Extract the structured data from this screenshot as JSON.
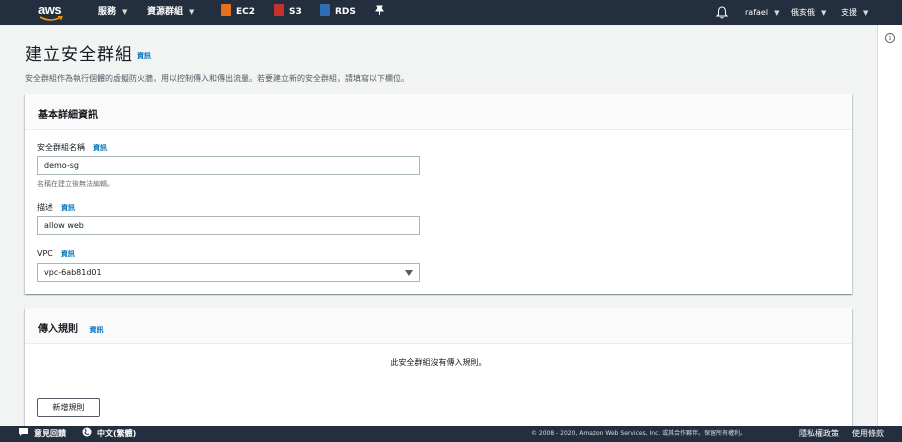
{
  "topnav": {
    "logo_text": "aws",
    "services_label": "服務",
    "resource_groups_label": "資源群組",
    "pinned": [
      {
        "label": "EC2",
        "color": "#e7711b"
      },
      {
        "label": "S3",
        "color": "#c7322f"
      },
      {
        "label": "RDS",
        "color": "#2f6db5"
      }
    ],
    "user_label": "rafael",
    "region_label": "俄亥俄",
    "support_label": "支援",
    "bg_color": "#232f3e"
  },
  "page": {
    "title": "建立安全群組",
    "title_info": "資訊",
    "description": "安全群組作為執行個體的虛擬防火牆，用以控制傳入和傳出流量。若要建立新的安全群組，請填寫以下欄位。"
  },
  "basic_details": {
    "title": "基本詳細資訊",
    "name_label": "安全群組名稱",
    "name_info": "資訊",
    "name_value": "demo-sg",
    "name_hint": "名稱在建立後無法編輯。",
    "desc_label": "描述",
    "desc_info": "資訊",
    "desc_value": "allow web",
    "vpc_label": "VPC",
    "vpc_info": "資訊",
    "vpc_value": "vpc-6ab81d01"
  },
  "inbound_rules": {
    "title": "傳入規則",
    "info": "資訊",
    "empty_text": "此安全群組沒有傳入規則。",
    "add_button": "新增規則"
  },
  "footer": {
    "feedback": "意見回饋",
    "language": "中文(繁體)",
    "copyright": "© 2008 - 2020, Amazon Web Services, Inc. 或其合作夥伴。保留所有權利。",
    "privacy": "隱私權政策",
    "terms": "使用條款"
  },
  "colors": {
    "link": "#0073bb",
    "accent_orange": "#ff9900"
  }
}
